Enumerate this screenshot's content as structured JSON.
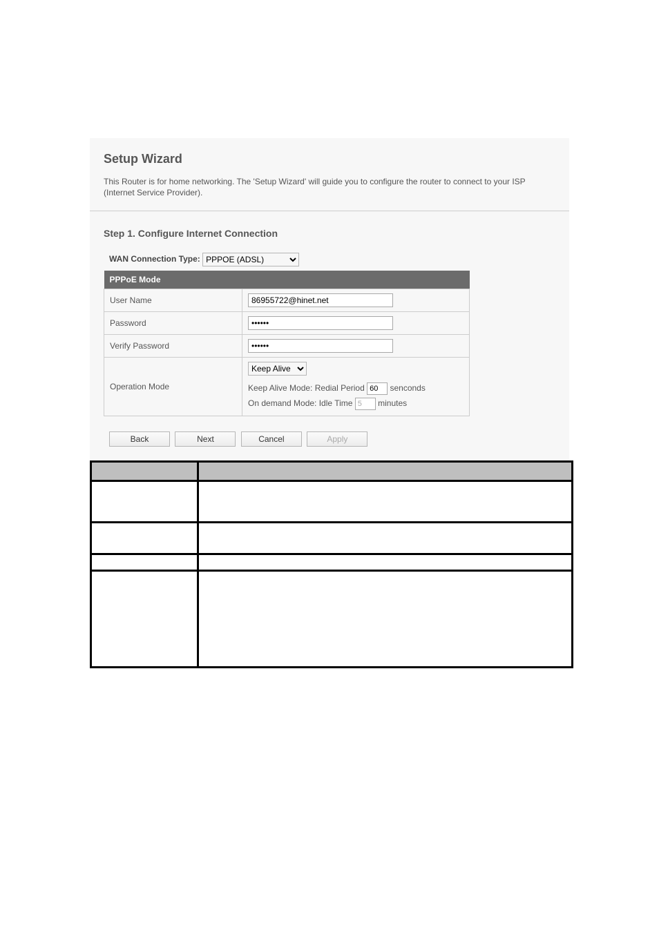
{
  "page": {
    "title": "Setup Wizard",
    "intro": "This Router is for home networking. The 'Setup Wizard' will guide you to configure the router to connect to your ISP (Internet Service Provider).",
    "step_title": "Step 1. Configure Internet Connection"
  },
  "wan": {
    "label": "WAN Connection Type:",
    "selected": "PPPOE (ADSL)"
  },
  "pppoe": {
    "header": "PPPoE Mode",
    "rows": {
      "user_name_label": "User Name",
      "user_name_value": "86955722@hinet.net",
      "password_label": "Password",
      "password_value": "••••••",
      "verify_password_label": "Verify Password",
      "verify_password_value": "••••••",
      "operation_mode_label": "Operation Mode",
      "operation_mode_selected": "Keep Alive",
      "keep_alive_text_a": "Keep Alive Mode: Redial Period",
      "keep_alive_value": "60",
      "keep_alive_unit": "senconds",
      "on_demand_text_a": "On demand Mode: Idle Time",
      "on_demand_value": "5",
      "on_demand_unit": "minutes"
    }
  },
  "buttons": {
    "back": "Back",
    "next": "Next",
    "cancel": "Cancel",
    "apply": "Apply"
  }
}
